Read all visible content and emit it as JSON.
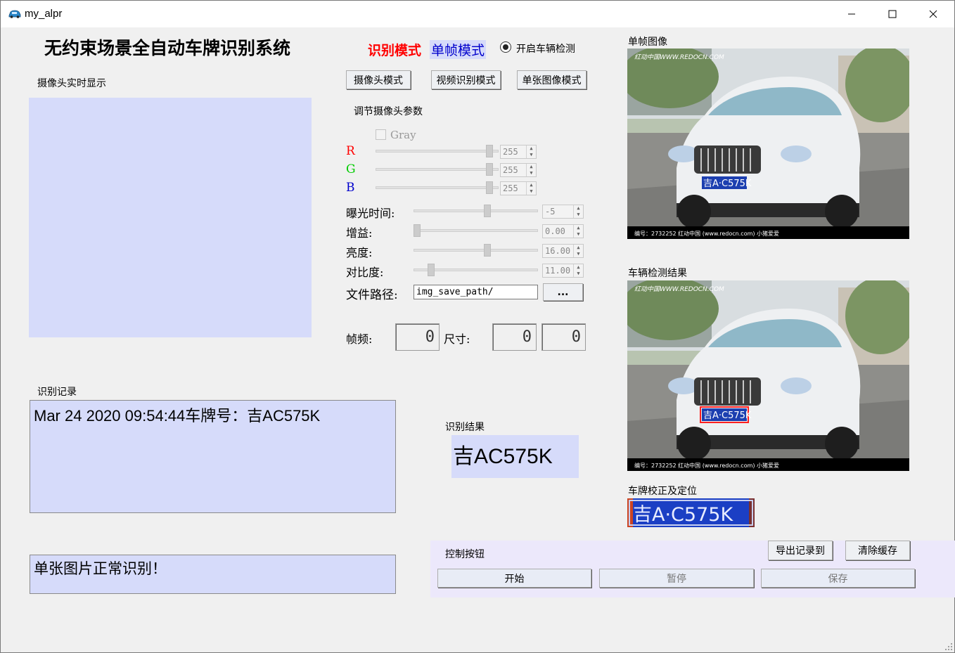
{
  "window": {
    "title": "my_alpr"
  },
  "header": {
    "title": "无约束场景全自动车牌识别系统",
    "mode_label": "识别模式",
    "mode_value": "单帧模式",
    "vehicle_detect_label": "开启车辆检测"
  },
  "camera": {
    "section_label": "摄像头实时显示"
  },
  "mode_buttons": {
    "camera": "摄像头模式",
    "video": "视频识别模式",
    "image": "单张图像模式"
  },
  "params": {
    "section_label": "调节摄像头参数",
    "gray_label": "Gray",
    "r_label": "R",
    "g_label": "G",
    "b_label": "B",
    "r_value": "255",
    "g_value": "255",
    "b_value": "255",
    "exposure_label": "曝光时间:",
    "exposure_value": "-5",
    "gain_label": "增益:",
    "gain_value": "0.00",
    "brightness_label": "亮度:",
    "brightness_value": "16.00",
    "contrast_label": "对比度:",
    "contrast_value": "11.00",
    "path_label": "文件路径:",
    "path_value": "img_save_path/",
    "browse_label": "...",
    "fps_label": "帧频:",
    "fps_value": "0",
    "size_label": "尺寸:",
    "width_value": "0",
    "height_value": "0"
  },
  "levels": {
    "r": 0.95,
    "g": 0.95,
    "b": 0.95,
    "exposure": 0.6,
    "gain": 0.0,
    "brightness": 0.6,
    "contrast": 0.12
  },
  "records": {
    "section_label": "识别记录",
    "entries": [
      "Mar 24 2020 09:54:44车牌号：吉AC575K"
    ]
  },
  "status": {
    "message": "单张图片正常识别！"
  },
  "result": {
    "section_label": "识别结果",
    "plate": "吉AC575K"
  },
  "images": {
    "frame_label": "单帧图像",
    "detect_label": "车辆检测结果",
    "plate_label": "车牌校正及定位",
    "watermark_top": "红动中国WWW.REDOCN.COM",
    "watermark_bottom": "编号：2732252   红动中国 (www.redocn.com)   小猪爱爱",
    "plate_text": "吉A·C575K"
  },
  "controls": {
    "section_label": "控制按钮",
    "export_label": "导出记录到",
    "clear_label": "清除缓存",
    "start_label": "开始",
    "pause_label": "暂停",
    "save_label": "保存"
  },
  "colors": {
    "accent_red": "#ff0000",
    "panel_blue": "#d6dbfa",
    "control_bg": "#ece8fb"
  }
}
